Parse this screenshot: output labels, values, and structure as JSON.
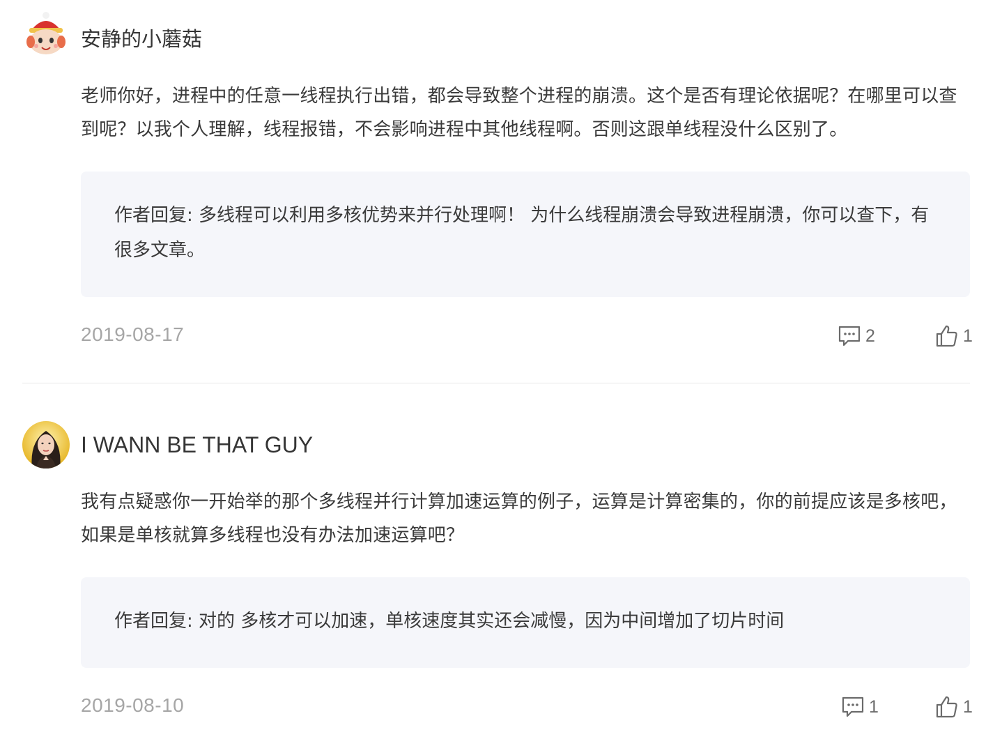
{
  "comments": [
    {
      "avatar_icon": "mushroom-avatar-icon",
      "username": "安静的小蘑菇",
      "body": "老师你好，进程中的任意一线程执行出错，都会导致整个进程的崩溃。这个是否有理论依据呢？在哪里可以查到呢？以我个人理解，线程报错，不会影响进程中其他线程啊。否则这跟单线程没什么区别了。",
      "reply": "作者回复: 多线程可以利用多核优势来并行处理啊！ 为什么线程崩溃会导致进程崩溃，你可以查下，有很多文章。",
      "date": "2019-08-17",
      "comment_count": "2",
      "like_count": "1"
    },
    {
      "avatar_icon": "user-photo-avatar-icon",
      "username": "I WANN BE THAT GUY",
      "body": "我有点疑惑你一开始举的那个多线程并行计算加速运算的例子，运算是计算密集的，你的前提应该是多核吧，如果是单核就算多线程也没有办法加速运算吧？",
      "reply": "作者回复: 对的 多核才可以加速，单核速度其实还会减慢，因为中间增加了切片时间",
      "date": "2019-08-10",
      "comment_count": "1",
      "like_count": "1"
    }
  ],
  "icons": {
    "comment": "comment-bubble-icon",
    "like": "thumbs-up-icon"
  },
  "colors": {
    "reply_background": "#f5f6fa",
    "date_text": "#a6a6a6",
    "divider": "#e8e8e8"
  }
}
